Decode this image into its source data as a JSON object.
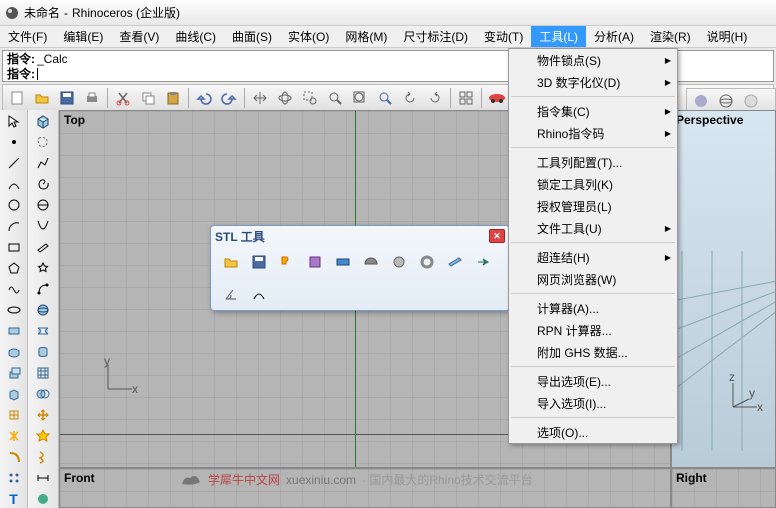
{
  "title": {
    "doc": "未命名",
    "app": "Rhinoceros (企业版)"
  },
  "menu": [
    "文件(F)",
    "编辑(E)",
    "查看(V)",
    "曲线(C)",
    "曲面(S)",
    "实体(O)",
    "网格(M)",
    "尺寸标注(D)",
    "变动(T)",
    "工具(L)",
    "分析(A)",
    "渲染(R)",
    "说明(H)"
  ],
  "menu_open_index": 9,
  "cmd": {
    "prev_label": "指令:",
    "prev_value": "_Calc",
    "cur_label": "指令:",
    "cur_value": ""
  },
  "dropdown": [
    {
      "label": "物件锁点(S)",
      "sub": true
    },
    {
      "label": "3D 数字化仪(D)",
      "sub": true
    },
    {
      "sep": true
    },
    {
      "label": "指令集(C)",
      "sub": true
    },
    {
      "label": "Rhino指令码",
      "sub": true
    },
    {
      "sep": true
    },
    {
      "label": "工具列配置(T)..."
    },
    {
      "label": "锁定工具列(K)"
    },
    {
      "label": "授权管理员(L)"
    },
    {
      "label": "文件工具(U)",
      "sub": true
    },
    {
      "sep": true
    },
    {
      "label": "超连结(H)",
      "sub": true
    },
    {
      "label": "网页浏览器(W)"
    },
    {
      "sep": true
    },
    {
      "label": "计算器(A)..."
    },
    {
      "label": "RPN 计算器..."
    },
    {
      "label": "附加 GHS 数据..."
    },
    {
      "sep": true
    },
    {
      "label": "导出选项(E)..."
    },
    {
      "label": "导入选项(I)..."
    },
    {
      "sep": true
    },
    {
      "label": "选项(O)..."
    }
  ],
  "stl": {
    "title": "STL 工具"
  },
  "viewports": {
    "tl": "Top",
    "tr": "Perspective",
    "bl": "Front",
    "br": "Right"
  },
  "watermark": {
    "site": "学犀牛中文网",
    "url": "xuexiniu.com",
    "tag": "- 国内最大的Rhino技术交流平台"
  }
}
